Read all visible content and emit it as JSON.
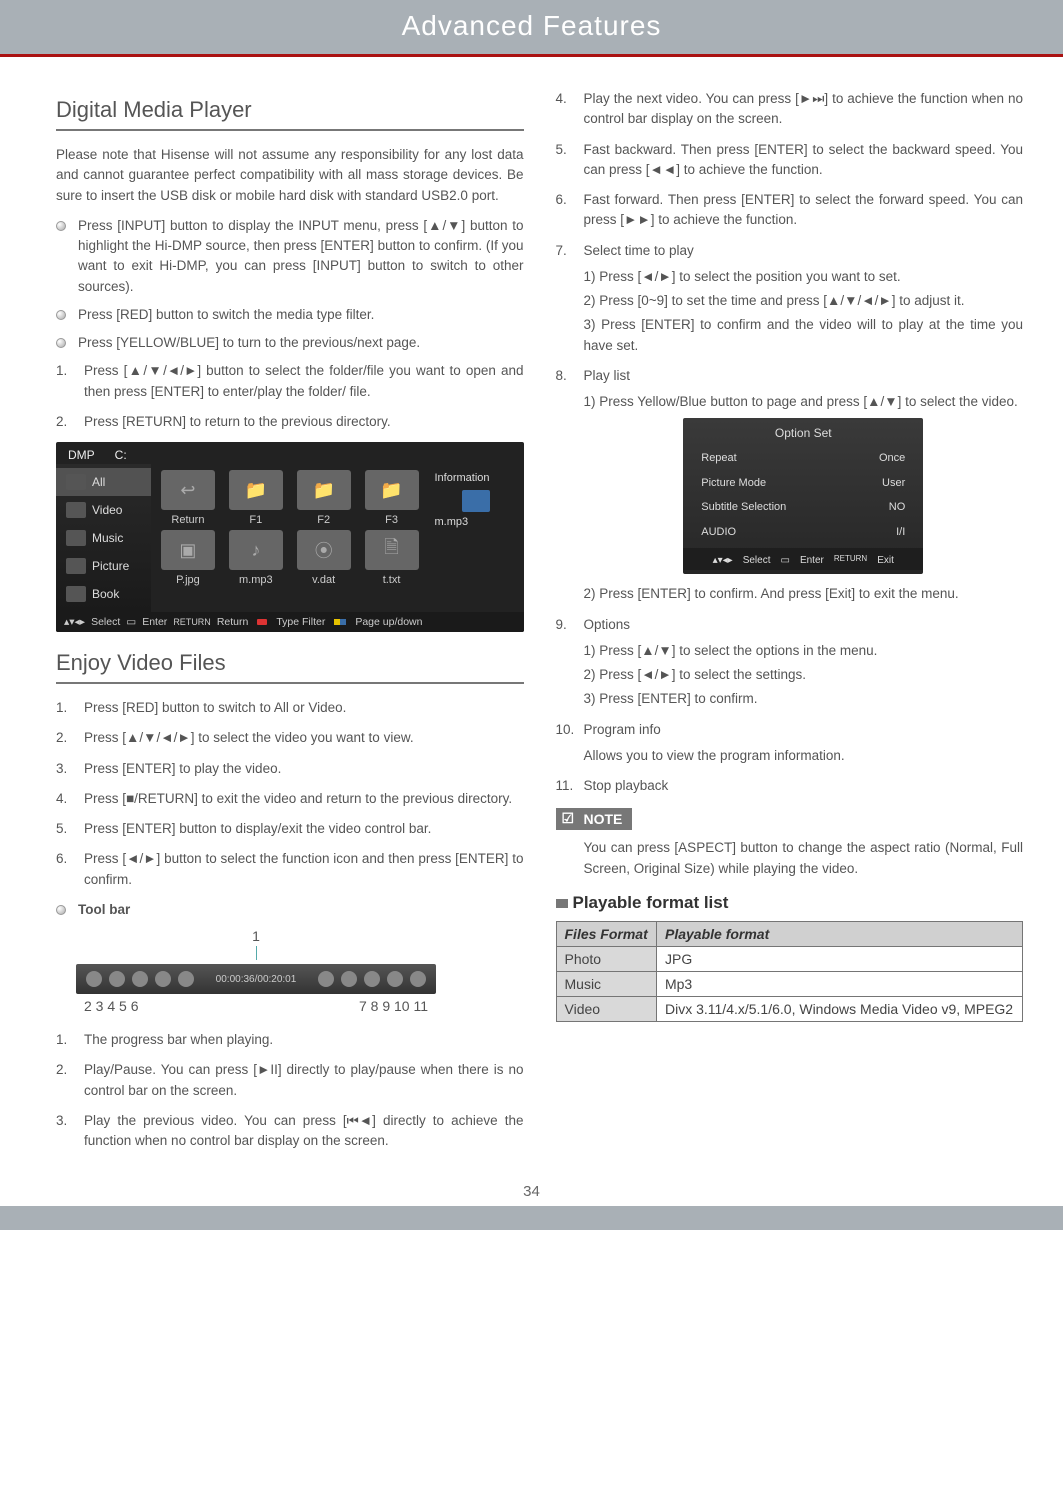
{
  "header": {
    "title": "Advanced Features"
  },
  "left": {
    "sec1_title": "Digital Media Player",
    "intro": "Please note that Hisense will not assume any responsibility for any lost data and cannot guarantee perfect compatibility with all mass storage devices. Be sure to insert the USB disk or mobile hard disk with standard USB2.0 port.",
    "bullets": [
      "Press [INPUT] button to display the INPUT menu, press [▲/▼] button to highlight the Hi-DMP source, then press [ENTER] button to confirm. (If you want to exit Hi-DMP, you can press [INPUT] button to switch to other sources).",
      "Press [RED] button to switch the media type filter.",
      "Press [YELLOW/BLUE] to turn to the previous/next page."
    ],
    "num1": [
      "Press [▲/▼/◄/►] button to select the folder/file you want to open and then press [ENTER] to enter/play the folder/ file.",
      "Press [RETURN] to return to the previous directory."
    ],
    "dmp": {
      "t1": "DMP",
      "t2": "C:",
      "side": [
        "All",
        "Video",
        "Music",
        "Picture",
        "Book"
      ],
      "cells": [
        {
          "thumb": "↩",
          "label": "Return"
        },
        {
          "thumb": "📁",
          "label": "F1"
        },
        {
          "thumb": "📁",
          "label": "F2"
        },
        {
          "thumb": "📁",
          "label": "F3"
        },
        {
          "thumb": "▣",
          "label": "P.jpg"
        },
        {
          "thumb": "♪",
          "label": "m.mp3"
        },
        {
          "thumb": "⦿",
          "label": "v.dat"
        },
        {
          "thumb": "🗎",
          "label": "t.txt"
        }
      ],
      "info_title": "Information",
      "info_file": "m.mp3",
      "bottom": {
        "select": "Select",
        "enter": "Enter",
        "return": "Return",
        "tf": "Type Filter",
        "pp": "Page up/down"
      }
    },
    "sec2_title": "Enjoy Video Files",
    "enjoy_list": [
      "Press [RED] button to switch to All or Video.",
      "Press [▲/▼/◄/►] to select the video you want to view.",
      "Press [ENTER] to play the video.",
      "Press [■/RETURN] to exit the video and return to the previous directory.",
      "Press [ENTER] button to display/exit the video control bar.",
      "Press [◄/►] button to select the function icon and then press [ENTER] to confirm."
    ],
    "toolbar_label": "Tool bar",
    "toolbar": {
      "top": "1",
      "time": "00:00:36/00:20:01",
      "nums_left": "2   3   4  5  6",
      "nums_right": "7   8   9 10  11"
    },
    "below_list": [
      "The progress bar when playing.",
      "Play/Pause. You can press [►II] directly to play/pause when there is no control bar on the screen.",
      "Play the previous video. You can press [⏮◄] directly to achieve the function when no control bar display on the screen."
    ]
  },
  "right": {
    "list4to11": [
      "Play the next video. You can press [►⏭] to achieve the function when no control bar display on the screen.",
      "Fast backward. Then press [ENTER] to select the backward speed. You can press [◄◄] to achieve the function.",
      "Fast forward. Then press [ENTER] to select the forward speed. You can press [►►] to achieve the function.",
      "Select time to play",
      "Play list",
      "Options",
      "Program info",
      "Stop playback"
    ],
    "sub7": [
      "1) Press [◄/►] to select the position you want to set.",
      "2) Press [0~9] to set the time and press [▲/▼/◄/►] to adjust it.",
      "3) Press [ENTER] to confirm and the video will to play at the time you have set."
    ],
    "sub8": [
      "1) Press Yellow/Blue button to page and press [▲/▼] to select the video."
    ],
    "sub8b": [
      "2) Press [ENTER] to confirm. And press [Exit] to exit the menu."
    ],
    "sub9": [
      "1) Press [▲/▼] to select the options in the menu.",
      "2) Press [◄/►] to select the settings.",
      "3) Press [ENTER] to confirm."
    ],
    "sub10": "Allows you to view the program information.",
    "option_set": {
      "title": "Option Set",
      "rows": [
        {
          "k": "Repeat",
          "v": "Once"
        },
        {
          "k": "Picture Mode",
          "v": "User"
        },
        {
          "k": "Subtitle Selection",
          "v": "NO"
        },
        {
          "k": "AUDIO",
          "v": "I/I"
        }
      ],
      "bottom": {
        "select": "Select",
        "enter": "Enter",
        "exit": "Exit"
      }
    },
    "note_label": "NOTE",
    "note_text": "You can press [ASPECT] button to change the aspect ratio (Normal, Full Screen, Original Size) while playing the video.",
    "playable_heading": "Playable format list",
    "table": {
      "h1": "Files Format",
      "h2": "Playable format",
      "rows": [
        {
          "a": "Photo",
          "b": "JPG"
        },
        {
          "a": "Music",
          "b": "Mp3"
        },
        {
          "a": "Video",
          "b": "Divx 3.11/4.x/5.1/6.0, Windows Media Video v9, MPEG2"
        }
      ]
    }
  },
  "page_num": "34"
}
